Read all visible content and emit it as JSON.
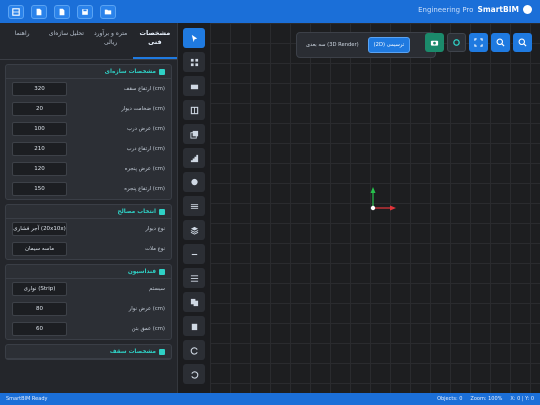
{
  "topbar": {
    "buttons": [
      "grid-icon",
      "save-doc-icon",
      "file-icon",
      "disk-icon",
      "folder-icon"
    ],
    "brand_subtitle": "Engineering Pro",
    "brand_name": "SmartBIM"
  },
  "panel": {
    "tabs": [
      "مشخصات فنی",
      "متره و برآورد ریالی",
      "تحلیل سازه‌ای",
      "راهنما"
    ],
    "sections": [
      {
        "title": "مشخصات سازه‌ای",
        "rows": [
          {
            "label": "ارتفاع سقف (cm)",
            "value": "320"
          },
          {
            "label": "ضخامت دیوار (cm)",
            "value": "20"
          },
          {
            "label": "عرض درب (cm)",
            "value": "100"
          },
          {
            "label": "ارتفاع درب (cm)",
            "value": "210"
          },
          {
            "label": "عرض پنجره (cm)",
            "value": "120"
          },
          {
            "label": "ارتفاع پنجره (cm)",
            "value": "150"
          }
        ]
      },
      {
        "title": "انتخاب مصالح",
        "rows": [
          {
            "label": "نوع دیوار",
            "value": "آجر فشاری (20x10x)"
          },
          {
            "label": "نوع ملات",
            "value": "ماسه سیمان"
          }
        ]
      },
      {
        "title": "فنداسیون",
        "rows": [
          {
            "label": "سیستم",
            "value": "نواری (Strip)"
          },
          {
            "label": "عرض نوار (cm)",
            "value": "80"
          },
          {
            "label": "عمق بتن (cm)",
            "value": "60"
          }
        ]
      },
      {
        "title": "مشخصات سقف",
        "rows": []
      }
    ]
  },
  "toolbar": {
    "tools": [
      "cursor-icon",
      "grid-icon",
      "wall-icon",
      "window-icon",
      "copy-icon",
      "stairs-icon",
      "chat-icon",
      "lines-icon",
      "layers-icon",
      "minus-icon",
      "list-icon",
      "duplicate-icon",
      "paste-icon",
      "redo-icon",
      "undo-icon"
    ]
  },
  "viewport": {
    "view_2d_label": "سه بعدی (3D Render)",
    "view_3d_label": "(2D) ترسیمی",
    "tools": [
      "camera-icon",
      "settings-icon",
      "fullscreen-icon",
      "zoom-in-icon",
      "zoom-out-icon"
    ]
  },
  "status": {
    "left": "SmartBIM Ready",
    "objects": "Objects: 0",
    "zoom": "Zoom: 100%",
    "coords": "X: 0 | Y: 0"
  },
  "colors": {
    "accent": "#1f7ae0",
    "section_title": "#2fd1c6",
    "axis_x": "#e0343a",
    "axis_y": "#27c24c"
  }
}
